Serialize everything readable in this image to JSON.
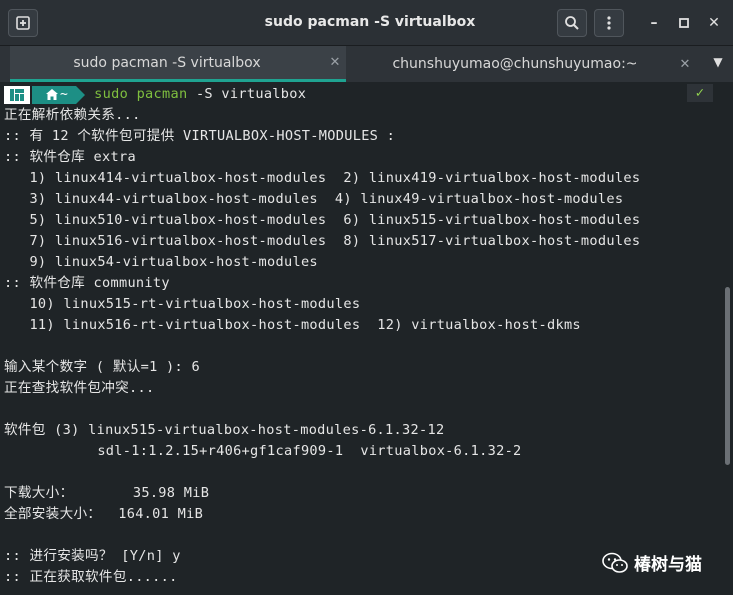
{
  "window": {
    "title": "sudo pacman -S virtualbox",
    "new_tab_icon": "new-tab-icon",
    "search_icon": "search-icon",
    "menu_icon": "kebab-menu-icon",
    "minimize": "–",
    "maximize": "□",
    "close": "✕"
  },
  "tabs": [
    {
      "label": "sudo pacman -S virtualbox",
      "close": "✕",
      "active": true
    },
    {
      "label": "chunshuyumao@chunshuyumao:~",
      "close": "✕",
      "active": false
    }
  ],
  "tabs_dropdown": "▼",
  "prompt": {
    "dir": "~",
    "home_icon": "home-icon",
    "cmd_sudo": "sudo",
    "cmd_pacman": "pacman",
    "cmd_args": " -S virtualbox",
    "status": "✓"
  },
  "output": [
    "正在解析依赖关系...",
    ":: 有 12 个软件包可提供 VIRTUALBOX-HOST-MODULES :",
    ":: 软件仓库 extra",
    "   1) linux414-virtualbox-host-modules  2) linux419-virtualbox-host-modules",
    "   3) linux44-virtualbox-host-modules  4) linux49-virtualbox-host-modules",
    "   5) linux510-virtualbox-host-modules  6) linux515-virtualbox-host-modules",
    "   7) linux516-virtualbox-host-modules  8) linux517-virtualbox-host-modules",
    "   9) linux54-virtualbox-host-modules",
    ":: 软件仓库 community",
    "   10) linux515-rt-virtualbox-host-modules",
    "   11) linux516-rt-virtualbox-host-modules  12) virtualbox-host-dkms",
    "",
    "输入某个数字 ( 默认=1 ): 6",
    "正在查找软件包冲突...",
    "",
    "软件包 (3) linux515-virtualbox-host-modules-6.1.32-12",
    "           sdl-1:1.2.15+r406+gf1caf909-1  virtualbox-6.1.32-2",
    "",
    "下载大小：       35.98 MiB",
    "全部安装大小：  164.01 MiB",
    "",
    ":: 进行安装吗？ [Y/n] y",
    ":: 正在获取软件包......"
  ],
  "watermark": {
    "text": "椿树与猫",
    "icon": "wechat-icon"
  },
  "colors": {
    "accent": "#1fa391",
    "prompt_bg": "#1d8f85",
    "command": "#7fbf3f",
    "ok": "#8fd14f"
  }
}
